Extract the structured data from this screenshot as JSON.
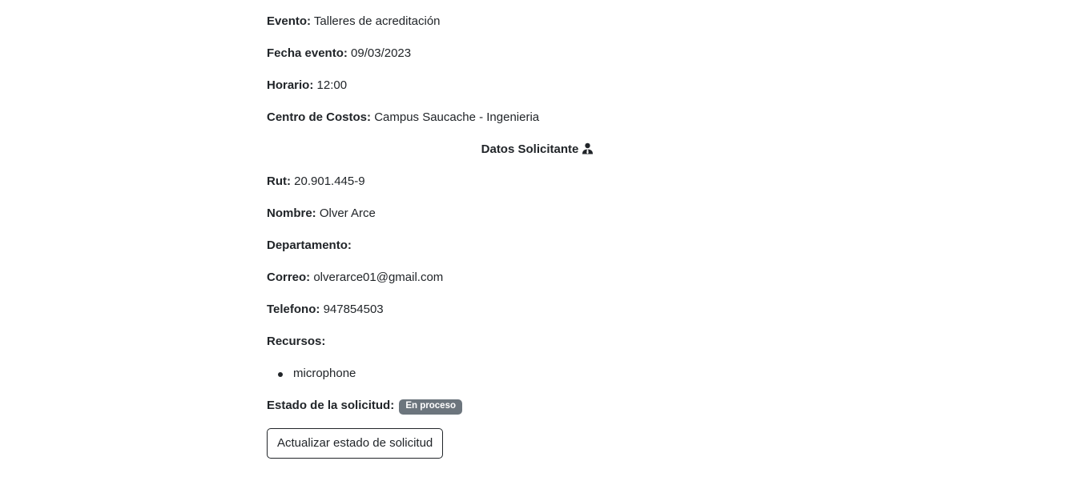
{
  "evento": {
    "label": "Evento:",
    "value": "Talleres de acreditación"
  },
  "fecha_evento": {
    "label": "Fecha evento:",
    "value": "09/03/2023"
  },
  "horario": {
    "label": "Horario:",
    "value": "12:00"
  },
  "centro_costos": {
    "label": "Centro de Costos:",
    "value": "Campus Saucache - Ingenieria"
  },
  "solicitante_title": "Datos Solicitante",
  "solicitante_icon": "person-tie-icon",
  "rut": {
    "label": "Rut:",
    "value": "20.901.445-9"
  },
  "nombre": {
    "label": "Nombre:",
    "value": "Olver Arce"
  },
  "departamento": {
    "label": "Departamento:",
    "value": ""
  },
  "correo": {
    "label": "Correo:",
    "value": "olverarce01@gmail.com"
  },
  "telefono": {
    "label": "Telefono:",
    "value": "947854503"
  },
  "recursos": {
    "label": "Recursos:",
    "items": [
      "microphone"
    ]
  },
  "estado": {
    "label": "Estado de la solicitud:",
    "badge": "En proceso",
    "badge_color": "#6c757d"
  },
  "actions": {
    "update_label": "Actualizar estado de solicitud"
  }
}
